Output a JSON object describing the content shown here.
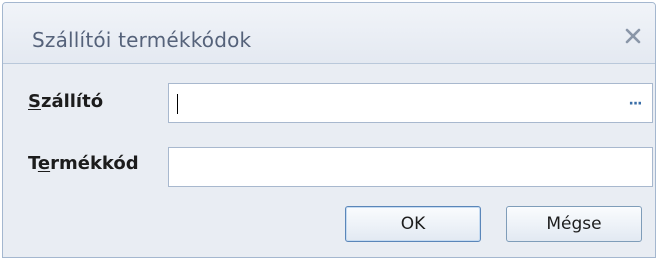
{
  "dialog": {
    "title": "Szállítói termékkódok",
    "close_icon": "close-icon"
  },
  "form": {
    "supplier": {
      "label_accel": "S",
      "label_rest": "zállító",
      "value": "",
      "browse_label": "···"
    },
    "product_code": {
      "label_pre": "T",
      "label_accel": "e",
      "label_rest": "rmékkód",
      "value": ""
    }
  },
  "buttons": {
    "ok_label": "OK",
    "cancel_label": "Mégse"
  },
  "colors": {
    "title_text": "#55627a",
    "border": "#a4b7cf",
    "body_bg": "#e9edf3",
    "browse_dots": "#3a6ea8"
  }
}
